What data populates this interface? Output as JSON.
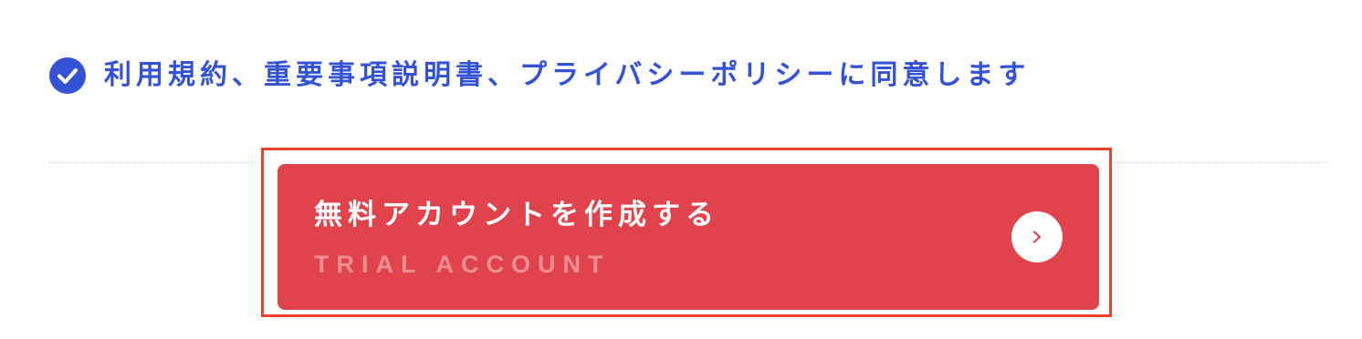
{
  "agreement": {
    "checked": true,
    "label": "利用規約、重要事項説明書、プライバシーポリシーに同意します",
    "icon": "check-circle-icon",
    "color": "#3452d6"
  },
  "cta": {
    "title": "無料アカウントを作成する",
    "subtitle": "TRIAL ACCOUNT",
    "icon": "chevron-right-icon",
    "background": "#e0434c",
    "highlight_color": "#e8412c"
  }
}
